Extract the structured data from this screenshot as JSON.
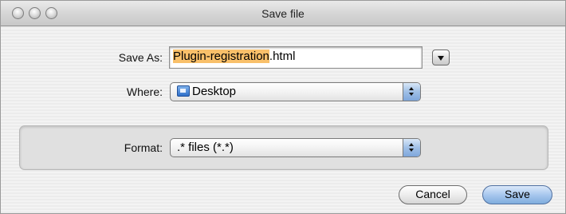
{
  "window": {
    "title": "Save file"
  },
  "save_as": {
    "label": "Save As:",
    "selected_part": "Plugin-registration",
    "rest": ".html"
  },
  "where": {
    "label": "Where:",
    "value": "Desktop"
  },
  "format": {
    "label": "Format:",
    "value": ".* files (*.*)"
  },
  "buttons": {
    "cancel": "Cancel",
    "save": "Save"
  },
  "colors": {
    "selection": "#f9c06a",
    "default_button": "#a8c7ee"
  },
  "icons": {
    "where_icon": "desktop-folder-icon",
    "expand": "disclosure-triangle-icon"
  }
}
